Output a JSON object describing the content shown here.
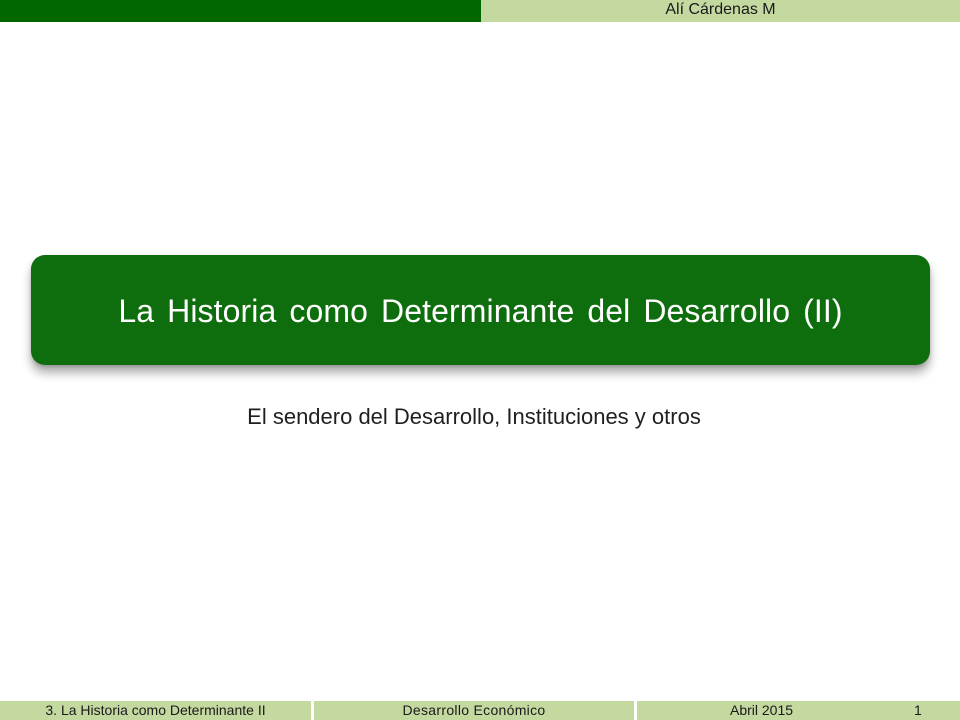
{
  "header": {
    "author": "Alí Cárdenas M"
  },
  "slide": {
    "title": "La Historia como Determinante del Desarrollo (II)",
    "subtitle": "El sendero del Desarrollo, Instituciones y otros"
  },
  "footer": {
    "left": "3. La Historia como Determinante II",
    "center": "Desarrollo Económico",
    "date": "Abril 2015",
    "page_number": "1"
  },
  "colors": {
    "dark_green": "#006600",
    "title_green": "#0e6e0e",
    "light_green": "#c4d9a0"
  }
}
